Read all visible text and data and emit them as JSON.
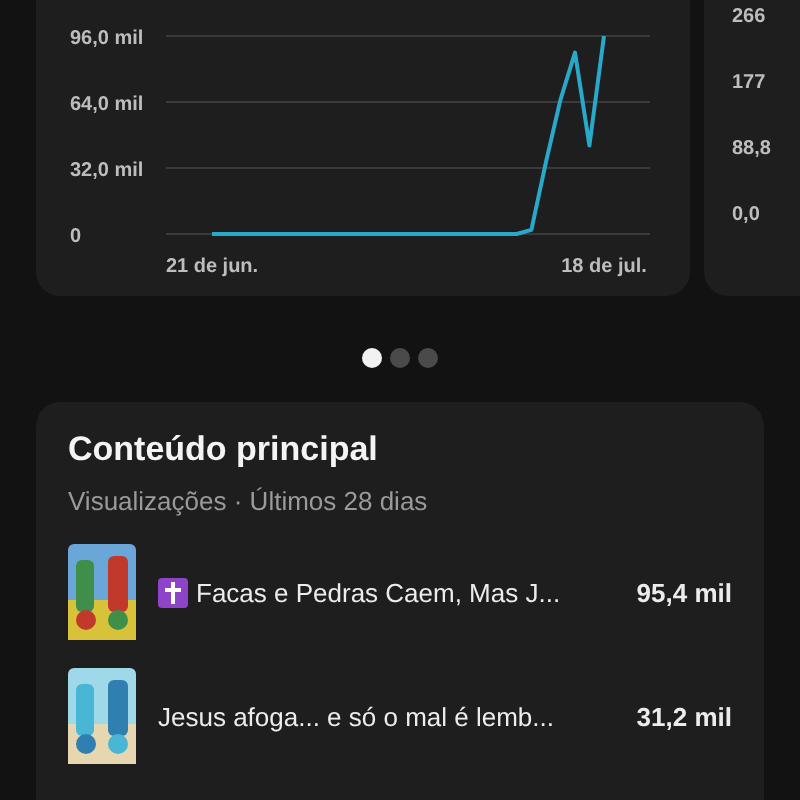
{
  "overview_chart": {
    "chart_data": {
      "type": "line",
      "categories": [
        "21 de jun.",
        null,
        null,
        null,
        null,
        null,
        null,
        null,
        null,
        null,
        null,
        null,
        null,
        null,
        null,
        null,
        null,
        null,
        null,
        null,
        null,
        null,
        null,
        null,
        null,
        null,
        null,
        "18 de jul."
      ],
      "grid": true,
      "yticks": [
        {
          "value": 0,
          "label": "0"
        },
        {
          "value": 32,
          "label": "32,0 mil"
        },
        {
          "value": 64,
          "label": "64,0 mil"
        },
        {
          "value": 96,
          "label": "96,0 mil"
        }
      ],
      "ylim": [
        0,
        96
      ],
      "series": [
        {
          "color": "#29a9c9",
          "values": [
            0,
            0,
            0,
            0,
            0,
            0,
            0,
            0,
            0,
            0,
            0,
            0,
            0,
            0,
            0,
            0,
            0,
            0,
            0,
            0,
            0,
            0,
            2,
            35,
            65,
            88,
            43,
            96
          ]
        }
      ]
    }
  },
  "side_card": {
    "axis_labels": [
      "266",
      "177",
      "88,8",
      "0,0"
    ]
  },
  "pager": {
    "dots": [
      {
        "selected": true
      },
      {
        "selected": false
      },
      {
        "selected": false
      }
    ]
  },
  "top_content": {
    "title": "Conteúdo principal",
    "subtitle": "Visualizações · Últimos 28 dias",
    "items": [
      {
        "title": "Facas e Pedras Caem, Mas J...",
        "views": "95,4 mil",
        "kind": "cross"
      },
      {
        "title": "Jesus afoga... e só o mal é lemb...",
        "views": "31,2 mil",
        "kind": "plain"
      }
    ]
  }
}
